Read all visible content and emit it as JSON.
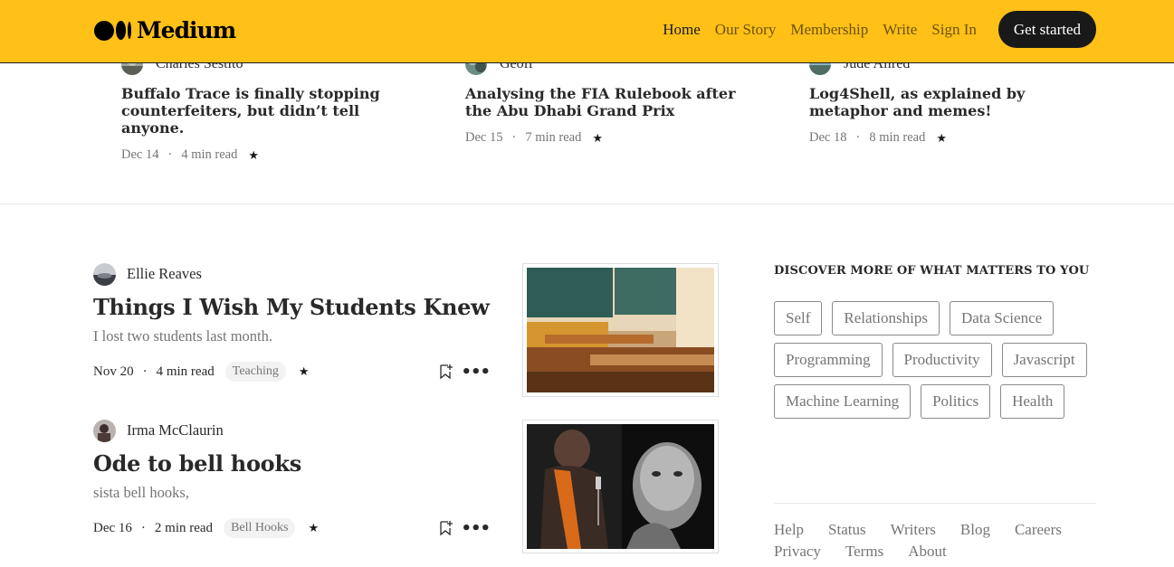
{
  "header": {
    "brand": "Medium",
    "nav": [
      "Home",
      "Our Story",
      "Membership",
      "Write",
      "Sign In"
    ],
    "cta": "Get started",
    "background": "#ffc017"
  },
  "trending": [
    {
      "author": "Charles Sestito",
      "title": "Buffalo Trace is finally stopping counterfeiters, but didn’t tell anyone.",
      "date": "Dec 14",
      "read_time": "4 min read",
      "star": "★"
    },
    {
      "author": "Geoff",
      "title": "Analysing the FIA Rulebook after the Abu Dhabi Grand Prix",
      "date": "Dec 15",
      "read_time": "7 min read",
      "star": "★"
    },
    {
      "author": "Jude Allred",
      "title": "Log4Shell, as explained by metaphor and memes!",
      "date": "Dec 18",
      "read_time": "8 min read",
      "star": "★"
    }
  ],
  "feed": [
    {
      "author": "Ellie Reaves",
      "title": "Things I Wish My Students Knew",
      "subtitle": "I lost two students last month.",
      "date": "Nov 20",
      "read_time": "4 min read",
      "tag": "Teaching",
      "star": "★",
      "more": "•••"
    },
    {
      "author": "Irma McClaurin",
      "title": "Ode to bell hooks",
      "subtitle": "sista bell hooks,",
      "date": "Dec 16",
      "read_time": "2 min read",
      "tag": "Bell Hooks",
      "star": "★",
      "more": "•••"
    }
  ],
  "sidebar": {
    "heading": "DISCOVER MORE OF WHAT MATTERS TO YOU",
    "topics": [
      "Self",
      "Relationships",
      "Data Science",
      "Programming",
      "Productivity",
      "Javascript",
      "Machine Learning",
      "Politics",
      "Health"
    ],
    "footer": [
      "Help",
      "Status",
      "Writers",
      "Blog",
      "Careers",
      "Privacy",
      "Terms",
      "About"
    ]
  },
  "separator": "·"
}
